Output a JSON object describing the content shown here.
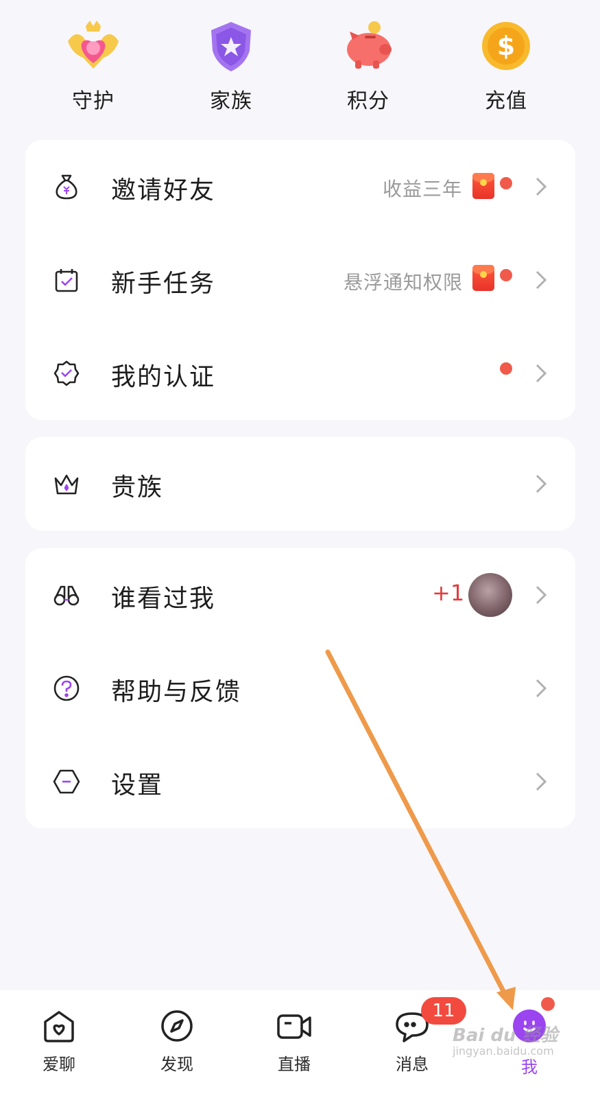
{
  "shortcuts": [
    {
      "label": "守护",
      "icon": "guard-heart-icon"
    },
    {
      "label": "家族",
      "icon": "family-shield-icon"
    },
    {
      "label": "积分",
      "icon": "piggy-bank-icon"
    },
    {
      "label": "充值",
      "icon": "coin-icon"
    }
  ],
  "menu": {
    "invite": {
      "label": "邀请好友",
      "sub": "收益三年",
      "icon": "money-bag-icon"
    },
    "newbie": {
      "label": "新手任务",
      "sub": "悬浮通知权限",
      "icon": "calendar-check-icon"
    },
    "verify": {
      "label": "我的认证",
      "icon": "badge-check-icon"
    },
    "noble": {
      "label": "贵族",
      "icon": "crown-icon"
    },
    "visitors": {
      "label": "谁看过我",
      "count": "+1",
      "icon": "binoculars-icon"
    },
    "help": {
      "label": "帮助与反馈",
      "icon": "question-circle-icon"
    },
    "settings": {
      "label": "设置",
      "icon": "hexagon-settings-icon"
    }
  },
  "tabs": [
    {
      "label": "爱聊",
      "icon": "heart-home-icon"
    },
    {
      "label": "发现",
      "icon": "compass-icon"
    },
    {
      "label": "直播",
      "icon": "video-camera-icon"
    },
    {
      "label": "消息",
      "icon": "chat-bubble-icon",
      "badge": "11"
    },
    {
      "label": "我",
      "icon": "profile-icon"
    }
  ],
  "watermark": {
    "text": "Bai du 经验",
    "url": "jingyan.baidu.com"
  },
  "colors": {
    "accent": "#9b45f1",
    "dot": "#f05a4b",
    "badge": "#f24a3f",
    "background": "#f7f6fb",
    "arrow": "#ee9a4a"
  }
}
